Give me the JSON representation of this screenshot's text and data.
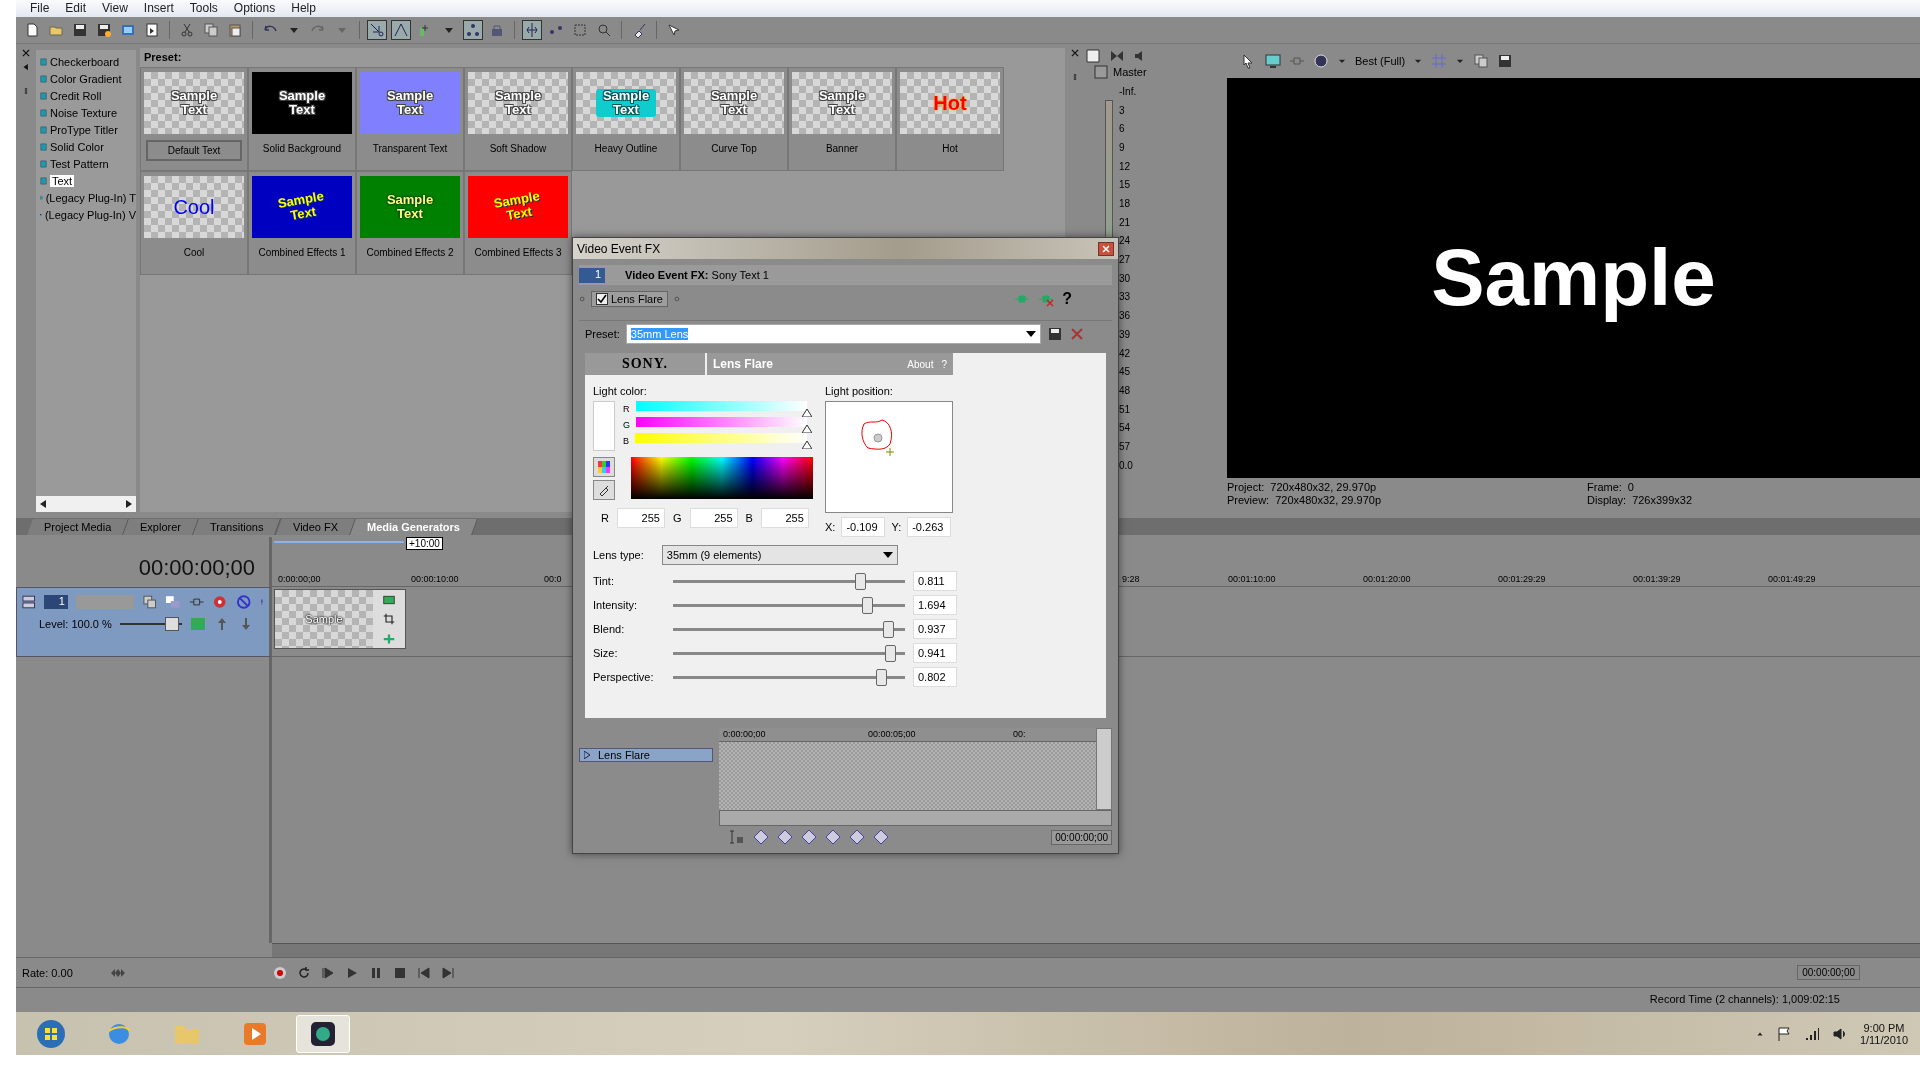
{
  "menu": [
    "File",
    "Edit",
    "View",
    "Insert",
    "Tools",
    "Options",
    "Help"
  ],
  "generators": [
    {
      "label": "Checkerboard",
      "selected": false
    },
    {
      "label": "Color Gradient",
      "selected": false
    },
    {
      "label": "Credit Roll",
      "selected": false
    },
    {
      "label": "Noise Texture",
      "selected": false
    },
    {
      "label": "ProType Titler",
      "selected": false
    },
    {
      "label": "Solid Color",
      "selected": false
    },
    {
      "label": "Test Pattern",
      "selected": false
    },
    {
      "label": "Text",
      "selected": true
    },
    {
      "label": "(Legacy Plug-In) T",
      "selected": false
    },
    {
      "label": "(Legacy Plug-In) V",
      "selected": false
    }
  ],
  "preset_title": "Preset:",
  "presets": [
    {
      "name": "Default Text",
      "thumb_text": "Sample Text",
      "kind": "plain",
      "selected": true
    },
    {
      "name": "Solid Background",
      "thumb_text": "Sample Text",
      "kind": "plain",
      "color": "#000000",
      "selected": false
    },
    {
      "name": "Transparent Text",
      "thumb_text": "Sample Text",
      "kind": "faded",
      "color": "#8080ff",
      "selected": false
    },
    {
      "name": "Soft Shadow",
      "thumb_text": "Sample Text",
      "kind": "shadow",
      "selected": false
    },
    {
      "name": "Heavy Outline",
      "thumb_text": "Sample Text",
      "kind": "outline",
      "selected": false
    },
    {
      "name": "Curve Top",
      "thumb_text": "Sample Text",
      "kind": "faded",
      "selected": false
    },
    {
      "name": "Banner",
      "thumb_text": "Sample Text",
      "kind": "faded",
      "selected": false
    },
    {
      "name": "Hot",
      "thumb_text": "Hot",
      "kind": "hot",
      "selected": false
    },
    {
      "name": "Cool",
      "thumb_text": "Cool",
      "kind": "cool",
      "selected": false
    },
    {
      "name": "Combined Effects 1",
      "thumb_text": "Sample Text",
      "kind": "effect",
      "color": "#0000c0",
      "selected": false
    },
    {
      "name": "Combined Effects 2",
      "thumb_text": "Sample Text",
      "kind": "glow",
      "color": "#008000",
      "selected": false
    },
    {
      "name": "Combined Effects 3",
      "thumb_text": "Sample Text",
      "kind": "effect",
      "color": "#ff0000",
      "selected": false
    }
  ],
  "tabs": [
    {
      "label": "Project Media",
      "selected": false
    },
    {
      "label": "Explorer",
      "selected": false
    },
    {
      "label": "Transitions",
      "selected": false
    },
    {
      "label": "Video FX",
      "selected": false
    },
    {
      "label": "Media Generators",
      "selected": true
    }
  ],
  "mixer": {
    "title": "Master",
    "top": "-Inf.",
    "scale": [
      "3",
      "6",
      "9",
      "12",
      "15",
      "18",
      "21",
      "24",
      "27",
      "30",
      "33",
      "36",
      "39",
      "42",
      "45",
      "48",
      "51",
      "54",
      "57"
    ],
    "reading": "0.0"
  },
  "preview": {
    "quality": "Best (Full)",
    "text": "Sample",
    "info": [
      {
        "label": "Project:",
        "value": "720x480x32, 29.970p"
      },
      {
        "label": "Preview:",
        "value": "720x480x32, 29.970p"
      },
      {
        "label": "Frame:",
        "value": "0"
      },
      {
        "label": "Display:",
        "value": "726x399x32"
      }
    ]
  },
  "timeline": {
    "timecode": "00:00:00;00",
    "loop_length": "+10:00",
    "ruler": [
      "0:00:00;00",
      "00:00:10:00",
      "00:0"
    ],
    "ruler_right": [
      "9:28",
      "00:01:10:00",
      "00:01:20:00",
      "00:01:29:29",
      "00:01:39:29",
      "00:01:49:29"
    ],
    "track": {
      "number": "1",
      "level_text": "Level: 100.0 %",
      "level": 0.85
    },
    "clip": {
      "label": "Sample"
    }
  },
  "transport": {
    "rate": "Rate: 0.00",
    "time": "00:00:00;00",
    "record": "Record Time (2 channels): 1,009:02:15"
  },
  "clock": {
    "time": "9:00 PM",
    "date": "1/11/2010"
  },
  "dialog": {
    "title": "Video Event FX",
    "chain_index": "1",
    "heading": "**Video Event FX:** Sony Text 1",
    "plugin": {
      "label": "Lens Flare",
      "checked": true
    },
    "preset_label": "Preset:",
    "preset": "35mm Lens",
    "brand": "SONY.",
    "plugin_name": "Lens Flare",
    "about": "About",
    "help": "?",
    "light_color": "Light color:",
    "channels": [
      {
        "label": "R",
        "level": 1
      },
      {
        "label": "G",
        "level": 1
      },
      {
        "label": "B",
        "level": 1
      }
    ],
    "rgb": [
      {
        "label": "R",
        "value": "255"
      },
      {
        "label": "G",
        "value": "255"
      },
      {
        "label": "B",
        "value": "255"
      }
    ],
    "light_position": "Light position:",
    "position": [
      {
        "label": "X:",
        "value": "-0.109"
      },
      {
        "label": "Y:",
        "value": "-0.263"
      }
    ],
    "lens_type_label": "Lens type:",
    "lens_type": "35mm (9 elements)",
    "sliders": [
      {
        "label": "Tint:",
        "level": 0.81,
        "reading": "0.811"
      },
      {
        "label": "Intensity:",
        "level": 0.84,
        "reading": "1.694"
      },
      {
        "label": "Blend:",
        "level": 0.93,
        "reading": "0.937"
      },
      {
        "label": "Size:",
        "level": 0.94,
        "reading": "0.941"
      },
      {
        "label": "Perspective:",
        "level": 0.9,
        "reading": "0.802"
      }
    ],
    "keyframe_track": "Lens Flare",
    "keyframe_ruler": [
      "0:00:00;00",
      "00:00:05;00",
      "00:"
    ],
    "keyframe_time": "00:00:00;00"
  }
}
